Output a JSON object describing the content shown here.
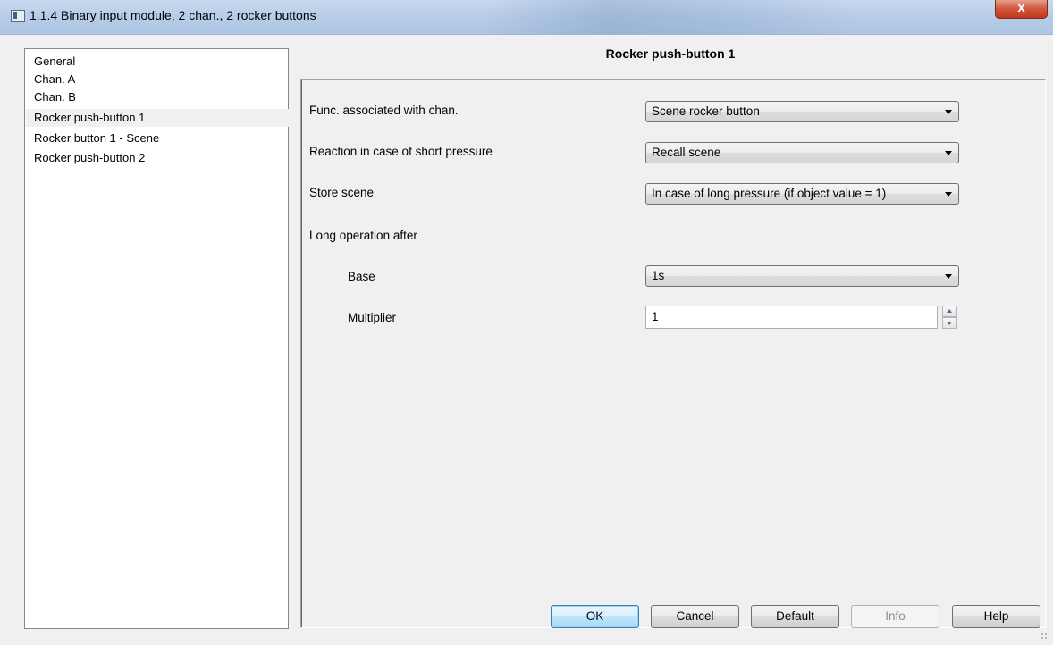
{
  "window": {
    "title": "1.1.4 Binary input module, 2 chan., 2 rocker buttons",
    "close_label": "x"
  },
  "tree": {
    "items": [
      {
        "label": "General"
      },
      {
        "label": "Chan. A"
      },
      {
        "label": "Chan. B"
      },
      {
        "label": "Rocker push-button 1",
        "selected": true
      },
      {
        "label": "Rocker button  1 - Scene"
      },
      {
        "label": "Rocker push-button 2"
      }
    ]
  },
  "panel": {
    "title": "Rocker push-button 1",
    "func_label": "Func. associated with chan.",
    "func_value": "Scene rocker button",
    "short_label": "Reaction in case of short pressure",
    "short_value": "Recall scene",
    "store_label": "Store scene",
    "store_value": "In case of long pressure (if object value = 1)",
    "long_label": "Long operation after",
    "base_label": "Base",
    "base_value": "1s",
    "multiplier_label": "Multiplier",
    "multiplier_value": "1"
  },
  "buttons": {
    "ok": "OK",
    "cancel": "Cancel",
    "default": "Default",
    "info": "Info",
    "help": "Help"
  }
}
